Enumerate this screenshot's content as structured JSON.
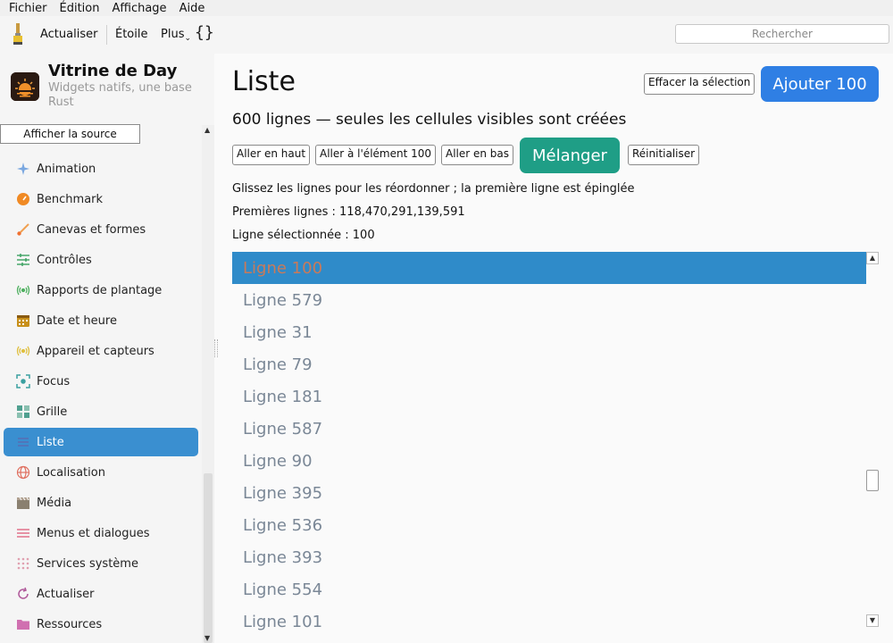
{
  "menubar": {
    "items": [
      "Fichier",
      "Édition",
      "Affichage",
      "Aide"
    ]
  },
  "toolbar": {
    "refresh_label": "Actualiser",
    "star_label": "Étoile",
    "more_label": "Plus",
    "braces": "{}",
    "search_placeholder": "Rechercher"
  },
  "sidebar": {
    "app_title": "Vitrine de Day",
    "app_subtitle": "Widgets natifs, une base Rust",
    "source_button": "Afficher la source",
    "items": [
      {
        "label": "Animation",
        "icon": "sparkle-icon",
        "color": "#7aa7e0"
      },
      {
        "label": "Benchmark",
        "icon": "gauge-icon",
        "color": "#f08a24"
      },
      {
        "label": "Canevas et formes",
        "icon": "brush-icon",
        "color": "#f0a050"
      },
      {
        "label": "Contrôles",
        "icon": "sliders-icon",
        "color": "#3aa060"
      },
      {
        "label": "Rapports de plantage",
        "icon": "broadcast-icon",
        "color": "#4fb060"
      },
      {
        "label": "Date et heure",
        "icon": "calendar-icon",
        "color": "#c8901a"
      },
      {
        "label": "Appareil et capteurs",
        "icon": "sensor-icon",
        "color": "#e0c040"
      },
      {
        "label": "Focus",
        "icon": "focus-icon",
        "color": "#3aa0a0"
      },
      {
        "label": "Grille",
        "icon": "grid-icon",
        "color": "#50a090"
      },
      {
        "label": "Liste",
        "icon": "list-icon",
        "color": "#5a6ab0"
      },
      {
        "label": "Localisation",
        "icon": "globe-icon",
        "color": "#e07060"
      },
      {
        "label": "Média",
        "icon": "clapper-icon",
        "color": "#8a8070"
      },
      {
        "label": "Menus et dialogues",
        "icon": "menu-icon",
        "color": "#e0708a"
      },
      {
        "label": "Services système",
        "icon": "dots-icon",
        "color": "#e0a0b0"
      },
      {
        "label": "Actualiser",
        "icon": "refresh-icon",
        "color": "#b05a9a"
      },
      {
        "label": "Ressources",
        "icon": "folder-icon",
        "color": "#d070b0"
      }
    ],
    "active_index": 9
  },
  "main": {
    "title": "Liste",
    "clear_button": "Effacer la sélection",
    "add_button": "Ajouter 100",
    "subtitle": "600 lignes — seules les cellules visibles sont créées",
    "buttons": {
      "top": "Aller en haut",
      "goto": "Aller à l'élément 100",
      "bottom": "Aller en bas",
      "shuffle": "Mélanger",
      "reset": "Réinitialiser"
    },
    "hint": "Glissez les lignes pour les réordonner ; la première ligne est épinglée",
    "first_rows": "Premières lignes : 118,470,291,139,591",
    "selected_line": "Ligne sélectionnée : 100",
    "rows": [
      "Ligne 100",
      "Ligne 579",
      "Ligne 31",
      "Ligne 79",
      "Ligne 181",
      "Ligne 587",
      "Ligne 90",
      "Ligne 395",
      "Ligne 536",
      "Ligne 393",
      "Ligne 554",
      "Ligne 101"
    ],
    "selected_row_index": 0,
    "selection_color": "#2f8bc9",
    "add_color": "#2f7fe4",
    "shuffle_color": "#1f9e86"
  }
}
